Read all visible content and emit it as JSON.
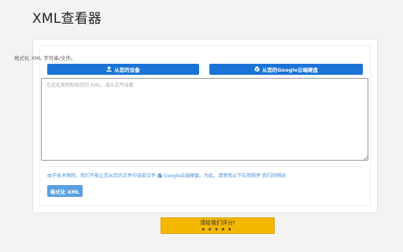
{
  "app": {
    "title": "XML查看器"
  },
  "main": {
    "hint": "格式化 XML 字符串/文件。",
    "device_button_label": "从您的设备",
    "drive_button_label": "从您的Google云端硬盘",
    "input": {
      "value": "",
      "placeholder": "在此处复制粘贴您的 XML，或从文件加载"
    },
    "notice": {
      "text_before": "由于技术限制，我们不能让您从您的文件中选取文件",
      "drive_link": "Google云端硬盘",
      "text_after": "。为此，请使用以下应用程序",
      "app_link": "我们的网站"
    },
    "format_button_label": "格式化 XML"
  },
  "footer": {
    "rate_label": "请给我们评分!",
    "stars": "★★★★★"
  },
  "colors": {
    "primary_blue": "#1a73d6",
    "format_blue": "#5b9fe0",
    "rate_yellow": "#f5b800",
    "link_blue": "#4a90d9"
  },
  "icons": {
    "device": "upload-icon",
    "drive": "google-drive-icon"
  }
}
